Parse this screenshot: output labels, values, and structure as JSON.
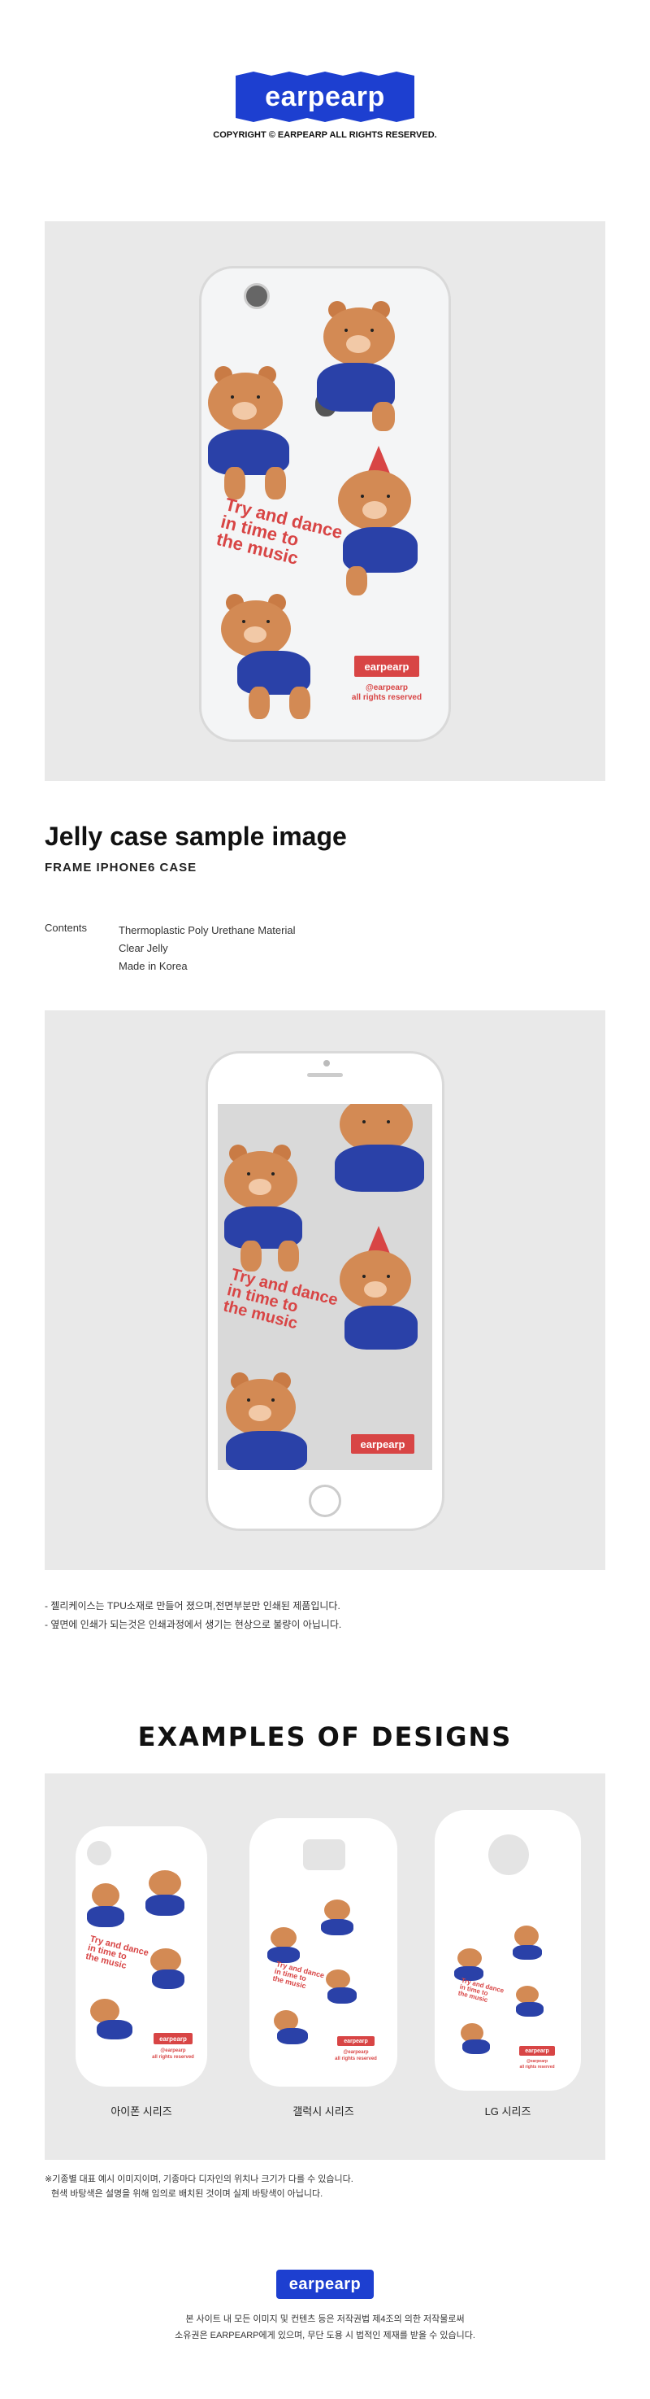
{
  "brand": {
    "logo_text": "earpearp",
    "copyright": "COPYRIGHT © EARPEARP ALL RIGHTS RESERVED."
  },
  "product": {
    "artwork_lines": [
      "Try and dance",
      "in time to",
      "the music"
    ],
    "case_logo": "earpearp",
    "case_credit": [
      "@earpearp",
      "all rights reserved"
    ],
    "title": "Jelly case sample image",
    "subtitle": "FRAME IPHONE6 CASE",
    "contents_label": "Contents",
    "contents": [
      "Thermoplastic Poly Urethane Material",
      "Clear Jelly",
      "Made in Korea"
    ]
  },
  "notes": [
    "- 젤리케이스는 TPU소재로 만들어 졌으며,전면부분만 인쇄된 제품입니다.",
    "- 옆면에 인쇄가 되는것은 인쇄과정에서 생기는 현상으로 불량이 아닙니다."
  ],
  "examples": {
    "title": "EXAMPLES OF DESIGNS",
    "labels": [
      "아이폰 시리즈",
      "갤럭시 시리즈",
      "LG 시리즈"
    ],
    "note_lines": [
      "※기종별 대표 예시 이미지이며, 기종마다 디자인의 위치나 크기가 다를 수 있습니다.",
      "현색 바탕색은 설명을 위해 임의로 배치된 것이며 실제 바탕색이 아닙니다."
    ]
  },
  "footer": {
    "logo_text": "earpearp",
    "lines": [
      "본 사이트 내 모든 이미지 및 컨텐츠 등은 저작권법 제4조의 의한 저작물로써",
      "소유권은 EARPEARP에게 있으며, 무단 도용 시 법적인 제재를 받을 수 있습니다."
    ]
  },
  "colors": {
    "brand_blue": "#1d3fd0",
    "accent_red": "#d84545",
    "bear_brown": "#d38a54",
    "shirt_blue": "#2a41a8",
    "panel_gray": "#e9e9e9"
  }
}
